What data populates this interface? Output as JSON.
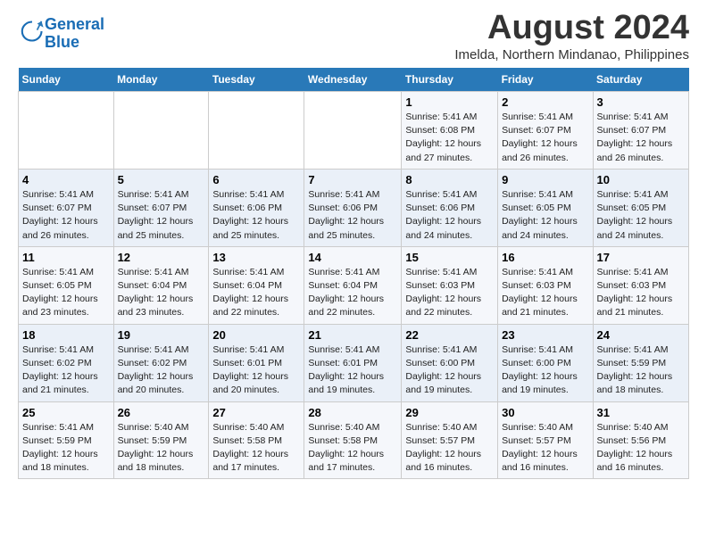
{
  "header": {
    "logo_line1": "General",
    "logo_line2": "Blue",
    "title": "August 2024",
    "subtitle": "Imelda, Northern Mindanao, Philippines"
  },
  "calendar": {
    "headers": [
      "Sunday",
      "Monday",
      "Tuesday",
      "Wednesday",
      "Thursday",
      "Friday",
      "Saturday"
    ],
    "weeks": [
      [
        {
          "day": "",
          "info": ""
        },
        {
          "day": "",
          "info": ""
        },
        {
          "day": "",
          "info": ""
        },
        {
          "day": "",
          "info": ""
        },
        {
          "day": "1",
          "info": "Sunrise: 5:41 AM\nSunset: 6:08 PM\nDaylight: 12 hours\nand 27 minutes."
        },
        {
          "day": "2",
          "info": "Sunrise: 5:41 AM\nSunset: 6:07 PM\nDaylight: 12 hours\nand 26 minutes."
        },
        {
          "day": "3",
          "info": "Sunrise: 5:41 AM\nSunset: 6:07 PM\nDaylight: 12 hours\nand 26 minutes."
        }
      ],
      [
        {
          "day": "4",
          "info": "Sunrise: 5:41 AM\nSunset: 6:07 PM\nDaylight: 12 hours\nand 26 minutes."
        },
        {
          "day": "5",
          "info": "Sunrise: 5:41 AM\nSunset: 6:07 PM\nDaylight: 12 hours\nand 25 minutes."
        },
        {
          "day": "6",
          "info": "Sunrise: 5:41 AM\nSunset: 6:06 PM\nDaylight: 12 hours\nand 25 minutes."
        },
        {
          "day": "7",
          "info": "Sunrise: 5:41 AM\nSunset: 6:06 PM\nDaylight: 12 hours\nand 25 minutes."
        },
        {
          "day": "8",
          "info": "Sunrise: 5:41 AM\nSunset: 6:06 PM\nDaylight: 12 hours\nand 24 minutes."
        },
        {
          "day": "9",
          "info": "Sunrise: 5:41 AM\nSunset: 6:05 PM\nDaylight: 12 hours\nand 24 minutes."
        },
        {
          "day": "10",
          "info": "Sunrise: 5:41 AM\nSunset: 6:05 PM\nDaylight: 12 hours\nand 24 minutes."
        }
      ],
      [
        {
          "day": "11",
          "info": "Sunrise: 5:41 AM\nSunset: 6:05 PM\nDaylight: 12 hours\nand 23 minutes."
        },
        {
          "day": "12",
          "info": "Sunrise: 5:41 AM\nSunset: 6:04 PM\nDaylight: 12 hours\nand 23 minutes."
        },
        {
          "day": "13",
          "info": "Sunrise: 5:41 AM\nSunset: 6:04 PM\nDaylight: 12 hours\nand 22 minutes."
        },
        {
          "day": "14",
          "info": "Sunrise: 5:41 AM\nSunset: 6:04 PM\nDaylight: 12 hours\nand 22 minutes."
        },
        {
          "day": "15",
          "info": "Sunrise: 5:41 AM\nSunset: 6:03 PM\nDaylight: 12 hours\nand 22 minutes."
        },
        {
          "day": "16",
          "info": "Sunrise: 5:41 AM\nSunset: 6:03 PM\nDaylight: 12 hours\nand 21 minutes."
        },
        {
          "day": "17",
          "info": "Sunrise: 5:41 AM\nSunset: 6:03 PM\nDaylight: 12 hours\nand 21 minutes."
        }
      ],
      [
        {
          "day": "18",
          "info": "Sunrise: 5:41 AM\nSunset: 6:02 PM\nDaylight: 12 hours\nand 21 minutes."
        },
        {
          "day": "19",
          "info": "Sunrise: 5:41 AM\nSunset: 6:02 PM\nDaylight: 12 hours\nand 20 minutes."
        },
        {
          "day": "20",
          "info": "Sunrise: 5:41 AM\nSunset: 6:01 PM\nDaylight: 12 hours\nand 20 minutes."
        },
        {
          "day": "21",
          "info": "Sunrise: 5:41 AM\nSunset: 6:01 PM\nDaylight: 12 hours\nand 19 minutes."
        },
        {
          "day": "22",
          "info": "Sunrise: 5:41 AM\nSunset: 6:00 PM\nDaylight: 12 hours\nand 19 minutes."
        },
        {
          "day": "23",
          "info": "Sunrise: 5:41 AM\nSunset: 6:00 PM\nDaylight: 12 hours\nand 19 minutes."
        },
        {
          "day": "24",
          "info": "Sunrise: 5:41 AM\nSunset: 5:59 PM\nDaylight: 12 hours\nand 18 minutes."
        }
      ],
      [
        {
          "day": "25",
          "info": "Sunrise: 5:41 AM\nSunset: 5:59 PM\nDaylight: 12 hours\nand 18 minutes."
        },
        {
          "day": "26",
          "info": "Sunrise: 5:40 AM\nSunset: 5:59 PM\nDaylight: 12 hours\nand 18 minutes."
        },
        {
          "day": "27",
          "info": "Sunrise: 5:40 AM\nSunset: 5:58 PM\nDaylight: 12 hours\nand 17 minutes."
        },
        {
          "day": "28",
          "info": "Sunrise: 5:40 AM\nSunset: 5:58 PM\nDaylight: 12 hours\nand 17 minutes."
        },
        {
          "day": "29",
          "info": "Sunrise: 5:40 AM\nSunset: 5:57 PM\nDaylight: 12 hours\nand 16 minutes."
        },
        {
          "day": "30",
          "info": "Sunrise: 5:40 AM\nSunset: 5:57 PM\nDaylight: 12 hours\nand 16 minutes."
        },
        {
          "day": "31",
          "info": "Sunrise: 5:40 AM\nSunset: 5:56 PM\nDaylight: 12 hours\nand 16 minutes."
        }
      ]
    ]
  }
}
